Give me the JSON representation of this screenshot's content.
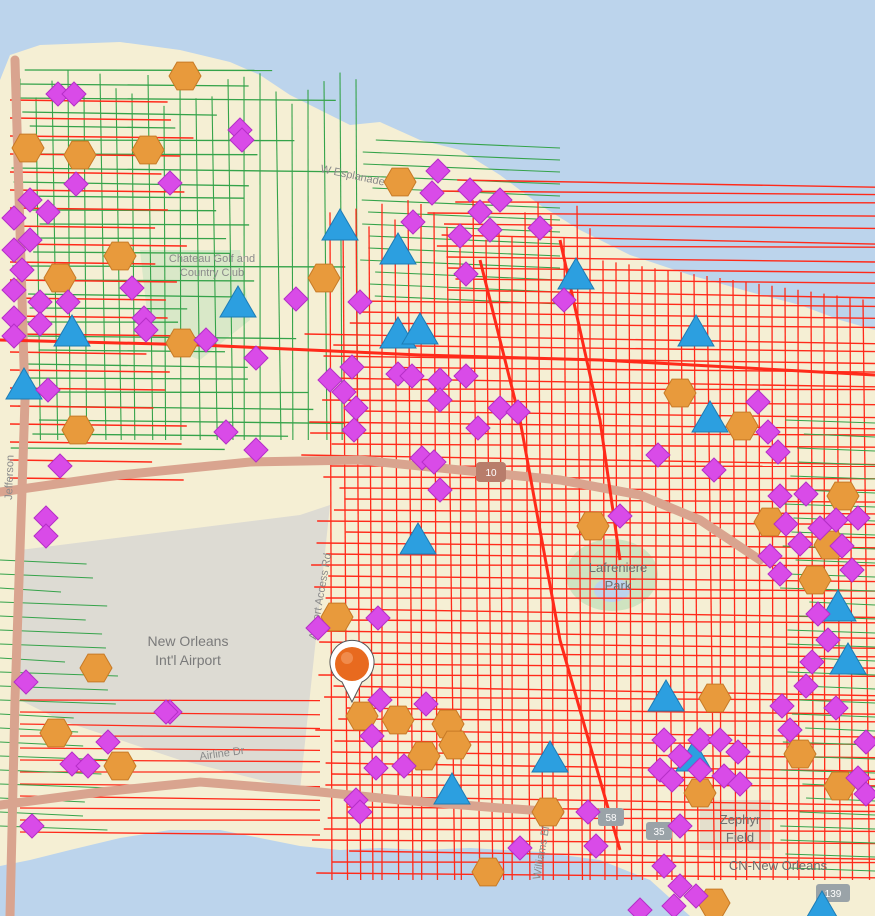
{
  "map": {
    "colors": {
      "water": "#bcd4ec",
      "land": "#f5efd4",
      "airport": "#dcdad2",
      "park": "#cfe3c0",
      "highway": "#d9a48f",
      "red_network": "#ff2a1a",
      "green_network": "#35a34a",
      "diamond": "#d94be8",
      "hexagon": "#e89a3c",
      "triangle": "#2c9fe0"
    },
    "labels": {
      "airport_line1": "New Orleans",
      "airport_line2": "Int'l Airport",
      "park_line1": "Lafreniere",
      "park_line2": "Park",
      "field_line1": "Zephyr",
      "field_line2": "Field",
      "cn": "CN-New Orleans",
      "golf_line1": "Chateau Golf and",
      "golf_line2": "Country Club",
      "blvd": "W Esplanade Blvd",
      "airport_access": "Airport Access Rd",
      "airline_dr": "Airline Dr",
      "west_street": "Williams Blvd",
      "jefferson": "Jefferson"
    },
    "shields": {
      "i10": "10",
      "r58": "58",
      "r139": "139",
      "r35": "35"
    },
    "legend_symbols": [
      "diamond-marker-icon",
      "hexagon-marker-icon",
      "triangle-marker-icon",
      "location-pin-icon"
    ]
  }
}
